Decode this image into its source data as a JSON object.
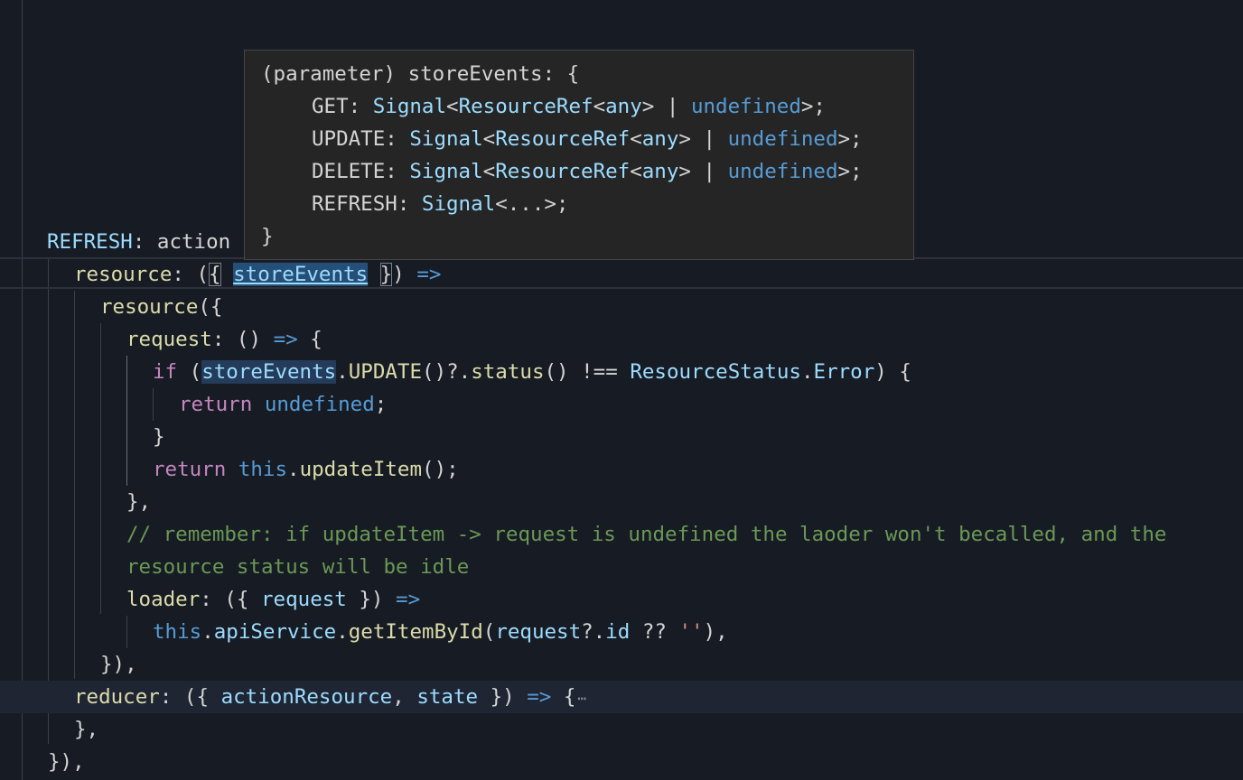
{
  "hover": {
    "line0": {
      "prefix": "(parameter) ",
      "name": "storeEvents",
      "suffix": ": {"
    },
    "rows": [
      {
        "key": "GET",
        "signal": "Signal",
        "ref": "ResourceRef",
        "any": "any",
        "undef": "undefined"
      },
      {
        "key": "UPDATE",
        "signal": "Signal",
        "ref": "ResourceRef",
        "any": "any",
        "undef": "undefined"
      },
      {
        "key": "DELETE",
        "signal": "Signal",
        "ref": "ResourceRef",
        "any": "any",
        "undef": "undefined"
      }
    ],
    "refresh": {
      "key": "REFRESH",
      "signal": "Signal",
      "rest": "<...>;"
    },
    "close": "}"
  },
  "code": {
    "l_refresh": {
      "key": "REFRESH",
      "after": ": action"
    },
    "l_resource": {
      "key": "resource",
      "param": "storeEvents"
    },
    "l_resource_call": "resource",
    "l_request": "request",
    "l_if": {
      "kw": "if",
      "obj": "storeEvents",
      "member": "UPDATE",
      "status": "status",
      "cls": "ResourceStatus",
      "err": "Error"
    },
    "l_return_undef": {
      "kw": "return",
      "val": "undefined"
    },
    "l_return_update": {
      "kw": "return",
      "this": "this",
      "fn": "updateItem"
    },
    "l_comment1": "// remember: if updateItem -> request is undefined the laoder won't becalled, and the",
    "l_comment2": "resource status will be idle",
    "l_loader": {
      "key": "loader",
      "param": "request"
    },
    "l_api": {
      "this": "this",
      "svc": "apiService",
      "fn": "getItemById",
      "arg": "request",
      "prop": "id",
      "str": "''"
    },
    "l_reducer": {
      "key": "reducer",
      "p1": "actionResource",
      "p2": "state"
    },
    "fold": "⋯"
  }
}
